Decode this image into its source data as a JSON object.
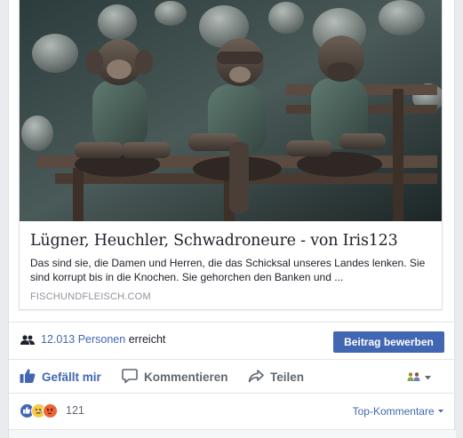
{
  "link_preview": {
    "image_alt": "Three bronze monkeys on a bench: see no evil, hear no evil, speak no evil",
    "title": "Lügner, Heuchler, Schwadroneure - von Iris123",
    "description": "Das sind sie, die Damen und Herren, die das Schicksal unseres Landes lenken. Sie sind korrupt bis in die Knochen. Sie gehorchen den Banken und ...",
    "domain": "FISCHUNDFLEISCH.COM"
  },
  "reach": {
    "count": "12.013 Personen",
    "suffix": "erreicht",
    "boost_label": "Beitrag bewerben"
  },
  "actions": {
    "like": "Gefällt mir",
    "comment": "Kommentieren",
    "share": "Teilen"
  },
  "reactions": {
    "count": "121",
    "sort_label": "Top-Kommentare"
  },
  "colors": {
    "accent": "#4267b2",
    "muted": "#606770",
    "page_bg": "#e9ebee"
  }
}
